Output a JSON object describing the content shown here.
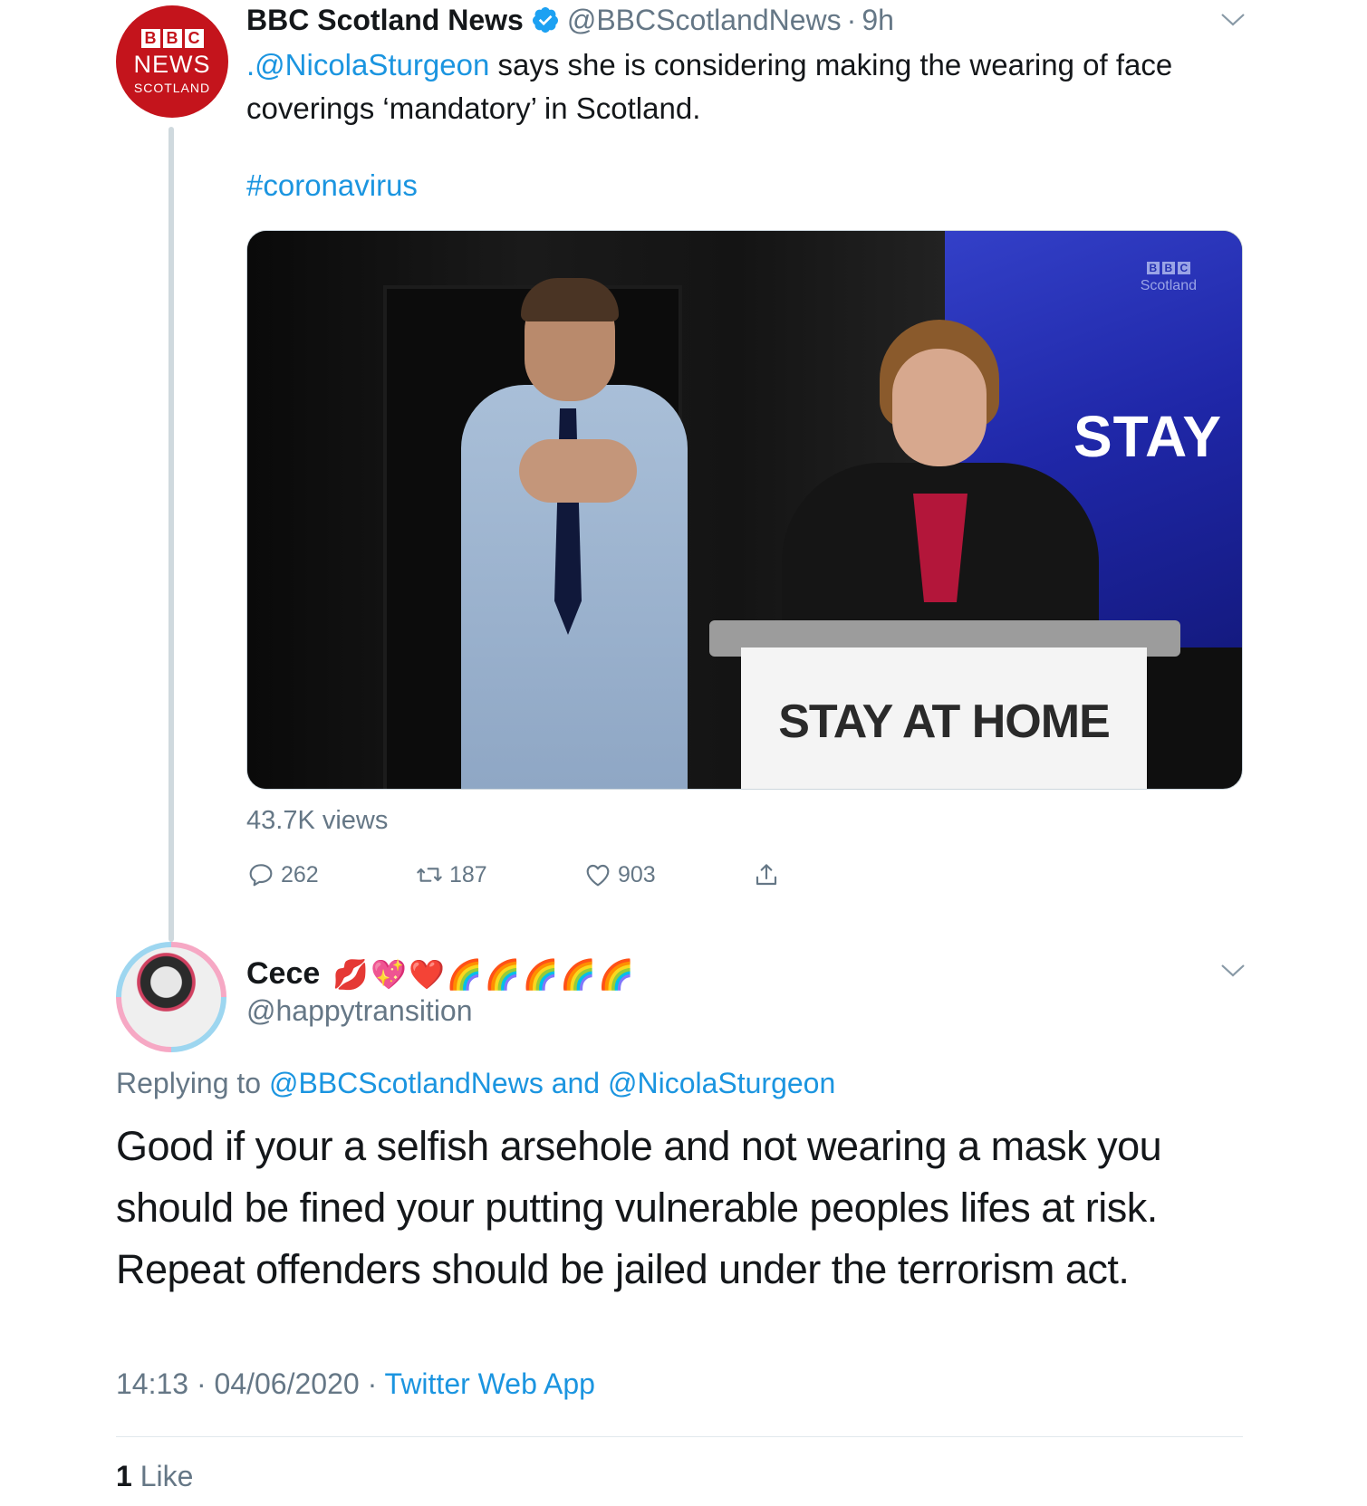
{
  "parent_tweet": {
    "author_name": "BBC Scotland News",
    "handle": "@BBCScotlandNews",
    "separator": "·",
    "time": "9h",
    "avatar": {
      "blocks": [
        "B",
        "B",
        "C"
      ],
      "line1": "NEWS",
      "line2": "SCOTLAND"
    },
    "text_mention": ".@NicolaSturgeon",
    "text_body": " says she is considering making the wearing of face coverings ‘mandatory’ in Scotland.",
    "hashtag": "#coronavirus",
    "media": {
      "screen_logo_blocks": [
        "B",
        "B",
        "C"
      ],
      "screen_logo_text": "Scotland",
      "screen_text": "STAY",
      "lectern_text": "STAY AT HOME"
    },
    "views": "43.7K views",
    "actions": {
      "reply_count": "262",
      "retweet_count": "187",
      "like_count": "903"
    },
    "icons": {
      "verified": "verified-badge-icon",
      "more": "chevron-down-icon",
      "reply": "reply-icon",
      "retweet": "retweet-icon",
      "like": "heart-icon",
      "share": "share-icon"
    },
    "colors": {
      "link": "#1b95e0",
      "muted": "#657786",
      "brand_red": "#c4141c"
    }
  },
  "reply_tweet": {
    "author_name": "Cece",
    "name_emoji": "💋💖❤️🌈🌈🌈🌈🌈",
    "handle": "@happytransition",
    "replying_prefix": "Replying to ",
    "replying_to_1": "@BBCScotlandNews",
    "replying_and": " and ",
    "replying_to_2": "@NicolaSturgeon",
    "text": "Good if your a selfish arsehole and not wearing a mask you should be fined your putting vulnerable peoples lifes at risk. Repeat offenders should be jailed under the terrorism act.",
    "time": "14:13",
    "separator": "·",
    "date": "04/06/2020",
    "source": "Twitter Web App",
    "like_count": "1",
    "like_label": "Like"
  }
}
